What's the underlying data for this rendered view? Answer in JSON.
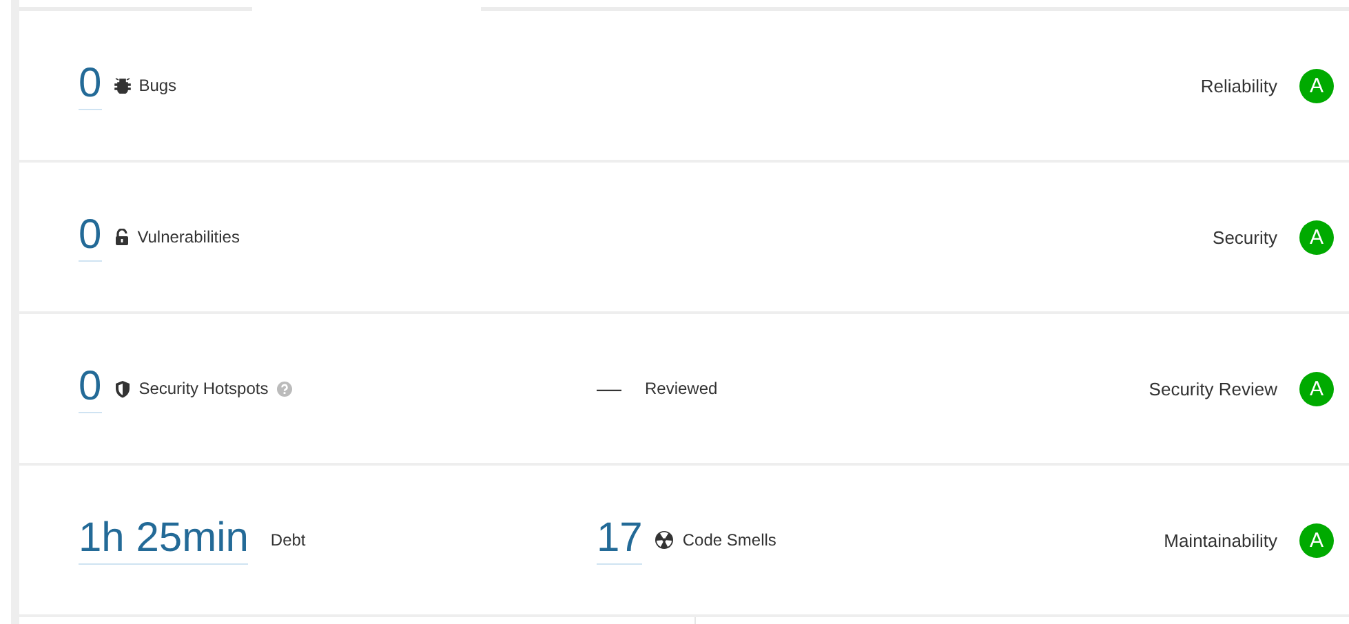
{
  "rows": [
    {
      "value": "0",
      "label": "Bugs",
      "help": false,
      "rating_label": "Reliability",
      "rating": "A"
    },
    {
      "value": "0",
      "label": "Vulnerabilities",
      "help": false,
      "rating_label": "Security",
      "rating": "A"
    },
    {
      "value": "0",
      "label": "Security Hotspots",
      "help": true,
      "middle": {
        "kind": "plain",
        "value": "—",
        "label": "Reviewed"
      },
      "rating_label": "Security Review",
      "rating": "A"
    },
    {
      "value": "1h 25min",
      "label": "Debt",
      "help": false,
      "middle": {
        "kind": "link",
        "value": "17",
        "label": "Code Smells"
      },
      "rating_label": "Maintainability",
      "rating": "A"
    }
  ]
}
